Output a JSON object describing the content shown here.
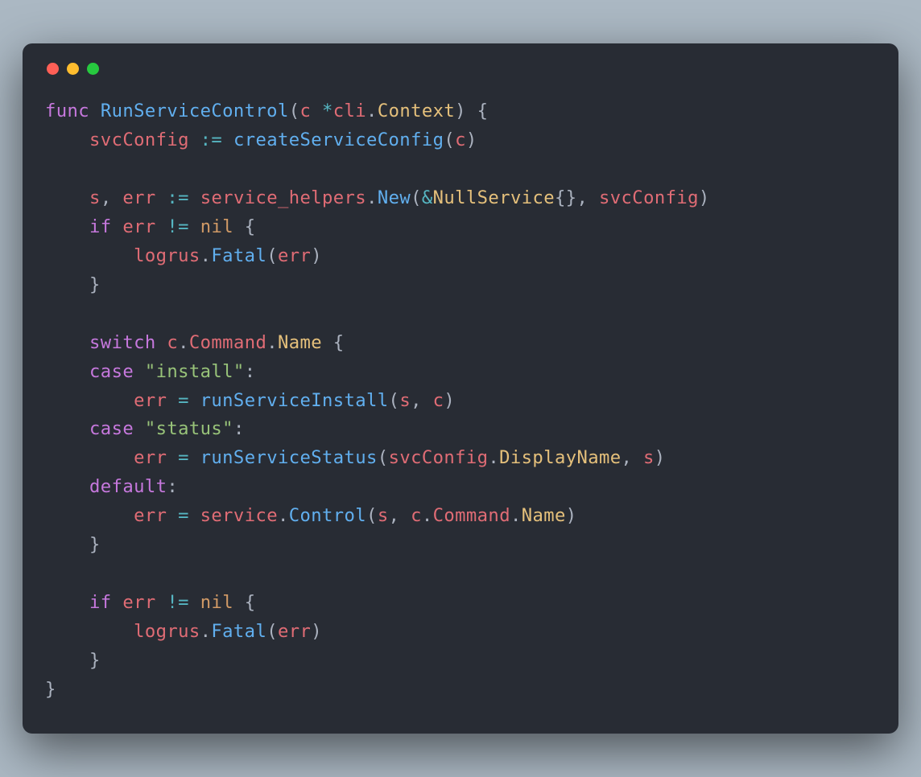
{
  "code": {
    "tokens": [
      [
        [
          "kw",
          "func"
        ],
        [
          "pn",
          " "
        ],
        [
          "fn",
          "RunServiceControl"
        ],
        [
          "pn",
          "("
        ],
        [
          "id",
          "c"
        ],
        [
          "pn",
          " "
        ],
        [
          "op",
          "*"
        ],
        [
          "id",
          "cli"
        ],
        [
          "pn",
          "."
        ],
        [
          "idc",
          "Context"
        ],
        [
          "pn",
          ") {"
        ]
      ],
      [
        [
          "pn",
          "    "
        ],
        [
          "id",
          "svcConfig"
        ],
        [
          "pn",
          " "
        ],
        [
          "op",
          ":="
        ],
        [
          "pn",
          " "
        ],
        [
          "fn",
          "createServiceConfig"
        ],
        [
          "pn",
          "("
        ],
        [
          "id",
          "c"
        ],
        [
          "pn",
          ")"
        ]
      ],
      [],
      [
        [
          "pn",
          "    "
        ],
        [
          "id",
          "s"
        ],
        [
          "pn",
          ", "
        ],
        [
          "id",
          "err"
        ],
        [
          "pn",
          " "
        ],
        [
          "op",
          ":="
        ],
        [
          "pn",
          " "
        ],
        [
          "id",
          "service_helpers"
        ],
        [
          "pn",
          "."
        ],
        [
          "fn",
          "New"
        ],
        [
          "pn",
          "("
        ],
        [
          "op",
          "&"
        ],
        [
          "idc",
          "NullService"
        ],
        [
          "pn",
          "{}, "
        ],
        [
          "id",
          "svcConfig"
        ],
        [
          "pn",
          ")"
        ]
      ],
      [
        [
          "pn",
          "    "
        ],
        [
          "kw",
          "if"
        ],
        [
          "pn",
          " "
        ],
        [
          "id",
          "err"
        ],
        [
          "pn",
          " "
        ],
        [
          "op",
          "!="
        ],
        [
          "pn",
          " "
        ],
        [
          "num",
          "nil"
        ],
        [
          "pn",
          " {"
        ]
      ],
      [
        [
          "pn",
          "        "
        ],
        [
          "id",
          "logrus"
        ],
        [
          "pn",
          "."
        ],
        [
          "fn",
          "Fatal"
        ],
        [
          "pn",
          "("
        ],
        [
          "id",
          "err"
        ],
        [
          "pn",
          ")"
        ]
      ],
      [
        [
          "pn",
          "    }"
        ]
      ],
      [],
      [
        [
          "pn",
          "    "
        ],
        [
          "kw",
          "switch"
        ],
        [
          "pn",
          " "
        ],
        [
          "id",
          "c"
        ],
        [
          "pn",
          "."
        ],
        [
          "id",
          "Command"
        ],
        [
          "pn",
          "."
        ],
        [
          "idc",
          "Name"
        ],
        [
          "pn",
          " {"
        ]
      ],
      [
        [
          "pn",
          "    "
        ],
        [
          "kw",
          "case"
        ],
        [
          "pn",
          " "
        ],
        [
          "str",
          "\"install\""
        ],
        [
          "pn",
          ":"
        ]
      ],
      [
        [
          "pn",
          "        "
        ],
        [
          "id",
          "err"
        ],
        [
          "pn",
          " "
        ],
        [
          "op",
          "="
        ],
        [
          "pn",
          " "
        ],
        [
          "fn",
          "runServiceInstall"
        ],
        [
          "pn",
          "("
        ],
        [
          "id",
          "s"
        ],
        [
          "pn",
          ", "
        ],
        [
          "id",
          "c"
        ],
        [
          "pn",
          ")"
        ]
      ],
      [
        [
          "pn",
          "    "
        ],
        [
          "kw",
          "case"
        ],
        [
          "pn",
          " "
        ],
        [
          "str",
          "\"status\""
        ],
        [
          "pn",
          ":"
        ]
      ],
      [
        [
          "pn",
          "        "
        ],
        [
          "id",
          "err"
        ],
        [
          "pn",
          " "
        ],
        [
          "op",
          "="
        ],
        [
          "pn",
          " "
        ],
        [
          "fn",
          "runServiceStatus"
        ],
        [
          "pn",
          "("
        ],
        [
          "id",
          "svcConfig"
        ],
        [
          "pn",
          "."
        ],
        [
          "idc",
          "DisplayName"
        ],
        [
          "pn",
          ", "
        ],
        [
          "id",
          "s"
        ],
        [
          "pn",
          ")"
        ]
      ],
      [
        [
          "pn",
          "    "
        ],
        [
          "kw",
          "default"
        ],
        [
          "pn",
          ":"
        ]
      ],
      [
        [
          "pn",
          "        "
        ],
        [
          "id",
          "err"
        ],
        [
          "pn",
          " "
        ],
        [
          "op",
          "="
        ],
        [
          "pn",
          " "
        ],
        [
          "id",
          "service"
        ],
        [
          "pn",
          "."
        ],
        [
          "fn",
          "Control"
        ],
        [
          "pn",
          "("
        ],
        [
          "id",
          "s"
        ],
        [
          "pn",
          ", "
        ],
        [
          "id",
          "c"
        ],
        [
          "pn",
          "."
        ],
        [
          "id",
          "Command"
        ],
        [
          "pn",
          "."
        ],
        [
          "idc",
          "Name"
        ],
        [
          "pn",
          ")"
        ]
      ],
      [
        [
          "pn",
          "    }"
        ]
      ],
      [],
      [
        [
          "pn",
          "    "
        ],
        [
          "kw",
          "if"
        ],
        [
          "pn",
          " "
        ],
        [
          "id",
          "err"
        ],
        [
          "pn",
          " "
        ],
        [
          "op",
          "!="
        ],
        [
          "pn",
          " "
        ],
        [
          "num",
          "nil"
        ],
        [
          "pn",
          " {"
        ]
      ],
      [
        [
          "pn",
          "        "
        ],
        [
          "id",
          "logrus"
        ],
        [
          "pn",
          "."
        ],
        [
          "fn",
          "Fatal"
        ],
        [
          "pn",
          "("
        ],
        [
          "id",
          "err"
        ],
        [
          "pn",
          ")"
        ]
      ],
      [
        [
          "pn",
          "    }"
        ]
      ],
      [
        [
          "pn",
          "}"
        ]
      ]
    ]
  },
  "traffic_lights": [
    "red",
    "yellow",
    "green"
  ]
}
